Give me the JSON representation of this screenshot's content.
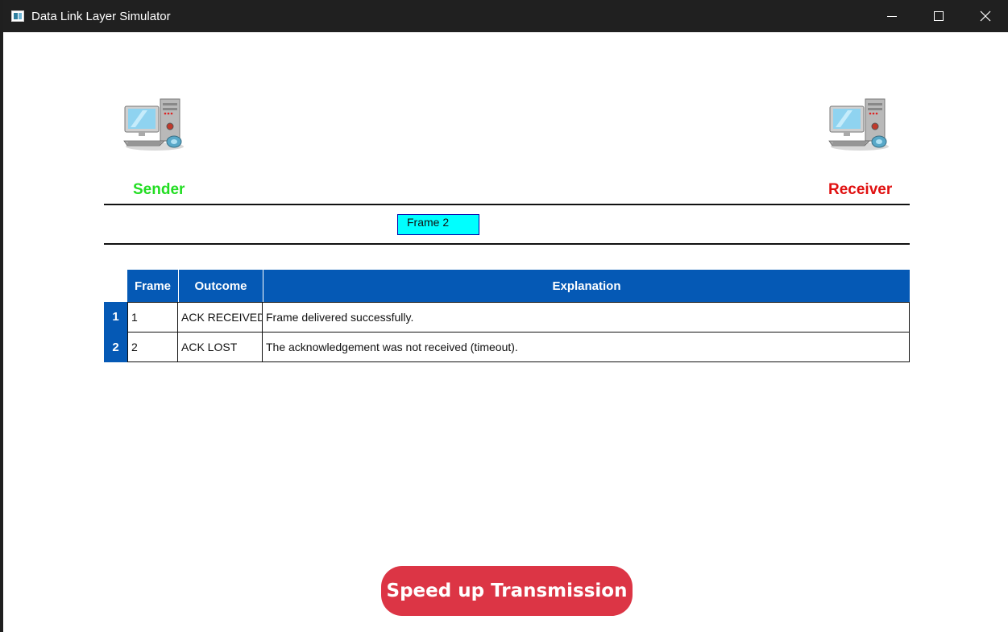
{
  "window": {
    "title": "Data Link Layer Simulator",
    "icon": "app-window-icon"
  },
  "simulator": {
    "sender_label": "Sender",
    "receiver_label": "Receiver",
    "sender_color": "#22dd22",
    "receiver_color": "#e01010",
    "computer_icon": "desktop-computer-icon",
    "frame_in_transit": "Frame 2",
    "frame_color": "#00ffff"
  },
  "table": {
    "header_color": "#0559b5",
    "columns": [
      "Frame",
      "Outcome",
      "Explanation"
    ],
    "rows": [
      {
        "row_header": "1",
        "frame": "1",
        "outcome": "ACK RECEIVED",
        "explanation": "Frame delivered successfully."
      },
      {
        "row_header": "2",
        "frame": "2",
        "outcome": "ACK LOST",
        "explanation": "The acknowledgement was not received (timeout)."
      }
    ]
  },
  "actions": {
    "speed_up_label": "Speed up Transmission",
    "speed_up_color": "#dc3545"
  }
}
